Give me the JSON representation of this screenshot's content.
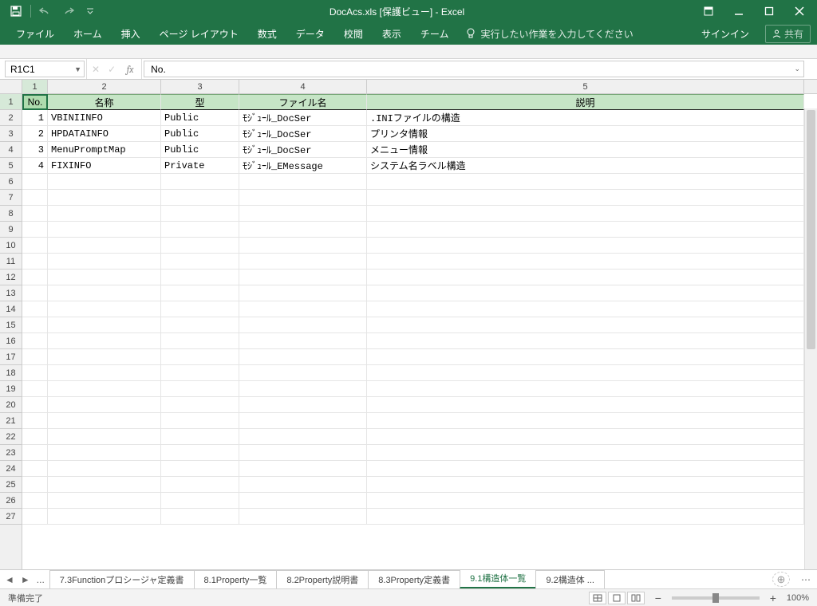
{
  "title": "DocAcs.xls  [保護ビュー] - Excel",
  "qat": {
    "save": "save",
    "undo": "undo",
    "redo": "redo"
  },
  "ribbon": {
    "file": "ファイル",
    "home": "ホーム",
    "insert": "挿入",
    "pagelayout": "ページ レイアウト",
    "formulas": "数式",
    "data": "データ",
    "review": "校閲",
    "view": "表示",
    "team": "チーム",
    "tellme_placeholder": "実行したい作業を入力してください",
    "signin": "サインイン",
    "share": "共有"
  },
  "namebox": "R1C1",
  "formula": "No.",
  "col_headers": [
    "1",
    "2",
    "3",
    "4",
    "5"
  ],
  "row_headers": [
    "1",
    "2",
    "3",
    "4",
    "5",
    "6",
    "7",
    "8",
    "9",
    "10",
    "11",
    "12",
    "13",
    "14",
    "15",
    "16",
    "17",
    "18",
    "19",
    "20",
    "21",
    "22",
    "23",
    "24",
    "25",
    "26",
    "27"
  ],
  "table": {
    "headers": {
      "no": "No.",
      "name": "名称",
      "type": "型",
      "file": "ファイル名",
      "desc": "説明"
    },
    "rows": [
      {
        "no": "1",
        "name": "VBINIINFO",
        "type": "Public",
        "file": "ﾓｼﾞｭｰﾙ_DocSer",
        "desc": ".INIファイルの構造"
      },
      {
        "no": "2",
        "name": "HPDATAINFO",
        "type": "Public",
        "file": "ﾓｼﾞｭｰﾙ_DocSer",
        "desc": "プリンタ情報"
      },
      {
        "no": "3",
        "name": "MenuPromptMap",
        "type": "Public",
        "file": "ﾓｼﾞｭｰﾙ_DocSer",
        "desc": "メニュー情報"
      },
      {
        "no": "4",
        "name": "FIXINFO",
        "type": "Private",
        "file": "ﾓｼﾞｭｰﾙ_EMessage",
        "desc": "システム名ラベル構造"
      }
    ]
  },
  "sheets": {
    "ellipsis": "...",
    "tabs": [
      "7.3Functionプロシージャ定義書",
      "8.1Property一覧",
      "8.2Property説明書",
      "8.3Property定義書",
      "9.1構造体一覧",
      "9.2構造体 ..."
    ],
    "active_index": 4
  },
  "status": {
    "ready": "準備完了",
    "zoom": "100%"
  }
}
